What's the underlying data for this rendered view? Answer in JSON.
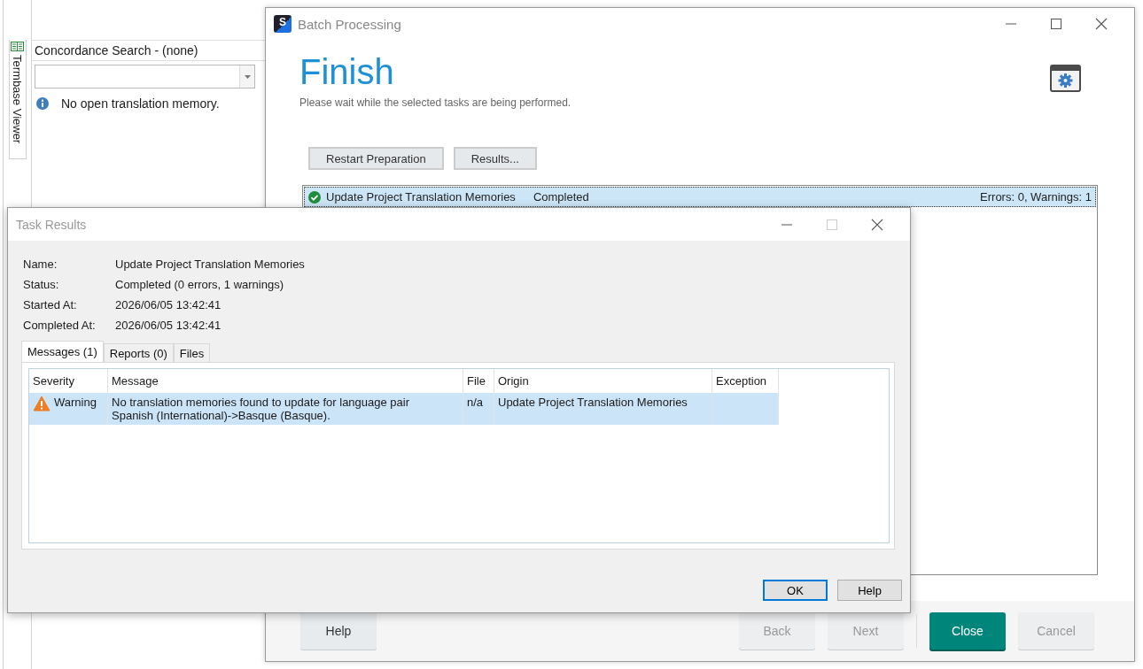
{
  "background_app": {
    "side_tab": "Termbase Viewer",
    "panel_title": "Concordance Search - (none)",
    "info_message": "No open translation memory."
  },
  "batch_window": {
    "logo": "S",
    "title": "Batch Processing",
    "heading": "Finish",
    "subtitle": "Please wait while the selected tasks are being performed.",
    "actions": [
      {
        "label": "Restart Preparation"
      },
      {
        "label": "Results..."
      }
    ],
    "tasks": [
      {
        "name": "Update Project Translation Memories",
        "status": "Completed",
        "summary": "Errors: 0, Warnings: 1",
        "selected": true
      }
    ],
    "footer_buttons": [
      {
        "label": "Help",
        "kind": "normal",
        "disabled": false
      },
      {
        "label": "Back",
        "kind": "normal",
        "disabled": true
      },
      {
        "label": "Next",
        "kind": "normal",
        "disabled": true
      },
      {
        "label": "Close",
        "kind": "primary",
        "disabled": false
      },
      {
        "label": "Cancel",
        "kind": "normal",
        "disabled": true
      }
    ]
  },
  "task_results": {
    "title": "Task Results",
    "fields": [
      {
        "label": "Name:",
        "value": "Update Project Translation Memories"
      },
      {
        "label": "Status:",
        "value": "Completed (0 errors, 1 warnings)"
      },
      {
        "label": "Started At:",
        "value": "2026/06/05 13:42:41"
      },
      {
        "label": "Completed At:",
        "value": "2026/06/05 13:42:41"
      }
    ],
    "tabs": [
      {
        "label": "Messages (1)",
        "selected": true
      },
      {
        "label": "Reports (0)",
        "selected": false
      },
      {
        "label": "Files",
        "selected": false
      }
    ],
    "table": {
      "columns": [
        "Severity",
        "Message",
        "File",
        "Origin",
        "Exception"
      ],
      "rows": [
        {
          "severity": "Warning",
          "message": "No translation memories found to update for language pair Spanish (International)->Basque (Basque).",
          "file": "n/a",
          "origin": "Update Project Translation Memories",
          "exception": "",
          "selected": true
        }
      ]
    },
    "buttons": [
      {
        "label": "OK",
        "kind": "default"
      },
      {
        "label": "Help",
        "kind": "normal"
      }
    ]
  }
}
